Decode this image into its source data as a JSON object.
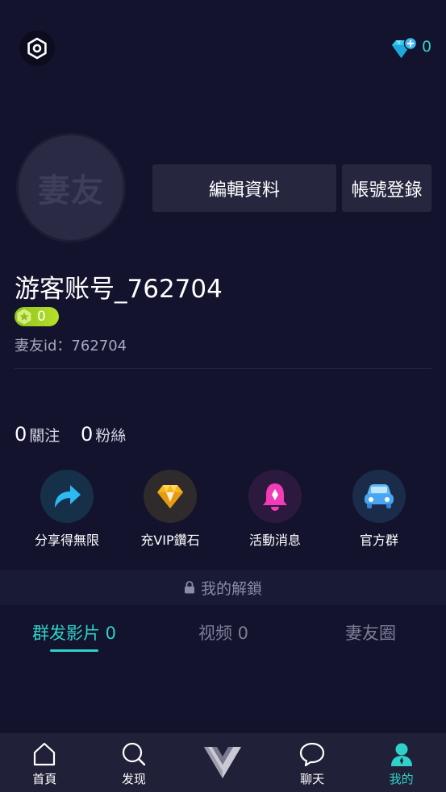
{
  "header": {
    "diamond_count": "0"
  },
  "profile": {
    "avatar_text": "妻友",
    "edit_label": "編輯資料",
    "login_label": "帳號登錄",
    "username": "游客账号_762704",
    "level": "0",
    "user_id": "妻友id：762704"
  },
  "stats": {
    "following_count": "0",
    "following_label": "關注",
    "fans_count": "0",
    "fans_label": "粉絲"
  },
  "quick_actions": [
    {
      "label": "分享得無限",
      "icon": "share-icon",
      "color": "#2db9f2"
    },
    {
      "label": "充VIP鑽石",
      "icon": "diamond-icon",
      "color": "#f5b21e"
    },
    {
      "label": "活動消息",
      "icon": "bell-icon",
      "color": "#f23bb6"
    },
    {
      "label": "官方群",
      "icon": "car-icon",
      "color": "#4aa6f3"
    }
  ],
  "unlock": {
    "label": "我的解鎖"
  },
  "tabs": [
    {
      "label": "群发影片 0",
      "active": true
    },
    {
      "label": "视频 0",
      "active": false
    },
    {
      "label": "妻友圈",
      "active": false
    }
  ],
  "colors": {
    "accent": "#2fd2c8",
    "background": "#13132e",
    "inactive_tab": "#7c7e96"
  },
  "bottom_nav": [
    {
      "label": "首頁",
      "icon": "home-icon"
    },
    {
      "label": "发现",
      "icon": "search-icon"
    },
    {
      "label": "",
      "icon": "logo-icon"
    },
    {
      "label": "聊天",
      "icon": "chat-icon"
    },
    {
      "label": "我的",
      "icon": "profile-icon",
      "active": true
    }
  ]
}
